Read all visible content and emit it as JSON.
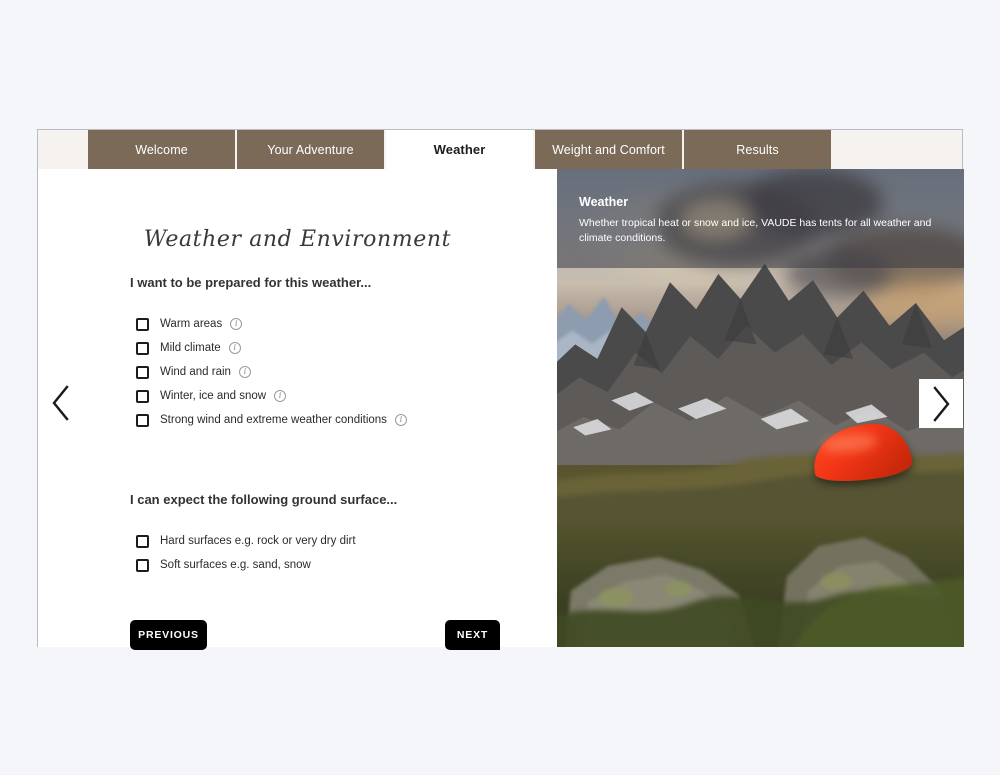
{
  "tabs": [
    {
      "label": "Welcome",
      "active": false
    },
    {
      "label": "Your Adventure",
      "active": false
    },
    {
      "label": "Weather",
      "active": true
    },
    {
      "label": "Weight and Comfort",
      "active": false
    },
    {
      "label": "Results",
      "active": false
    }
  ],
  "form": {
    "script_title": "Weather and Environment",
    "weather_heading": "I want to be prepared for this weather...",
    "weather_options": [
      {
        "label": "Warm areas",
        "info": true
      },
      {
        "label": "Mild climate",
        "info": true
      },
      {
        "label": "Wind and rain",
        "info": true
      },
      {
        "label": "Winter, ice and snow",
        "info": true
      },
      {
        "label": "Strong wind and extreme weather conditions",
        "info": true
      }
    ],
    "ground_heading": "I can expect the following ground surface...",
    "ground_options": [
      {
        "label": "Hard surfaces e.g. rock or very dry dirt",
        "info": false
      },
      {
        "label": "Soft surfaces e.g. sand, snow",
        "info": false
      }
    ],
    "info_glyph": "i",
    "previous_label": "PREVIOUS",
    "next_label": "NEXT"
  },
  "panel": {
    "title": "Weather",
    "description": "Whether tropical heat or snow and ice, VAUDE has tents for all weather and climate conditions."
  },
  "carousel": {
    "prev_glyph": "‹",
    "next_glyph": "›"
  },
  "colors": {
    "page_background": "#f5f6fa",
    "tabbar_background": "#f5f2ef",
    "tab_brown": "#7a6a57",
    "tab_active_background": "#ffffff",
    "button_black": "#000000",
    "tent_red": "#f03415",
    "heading_text": "#333333"
  }
}
